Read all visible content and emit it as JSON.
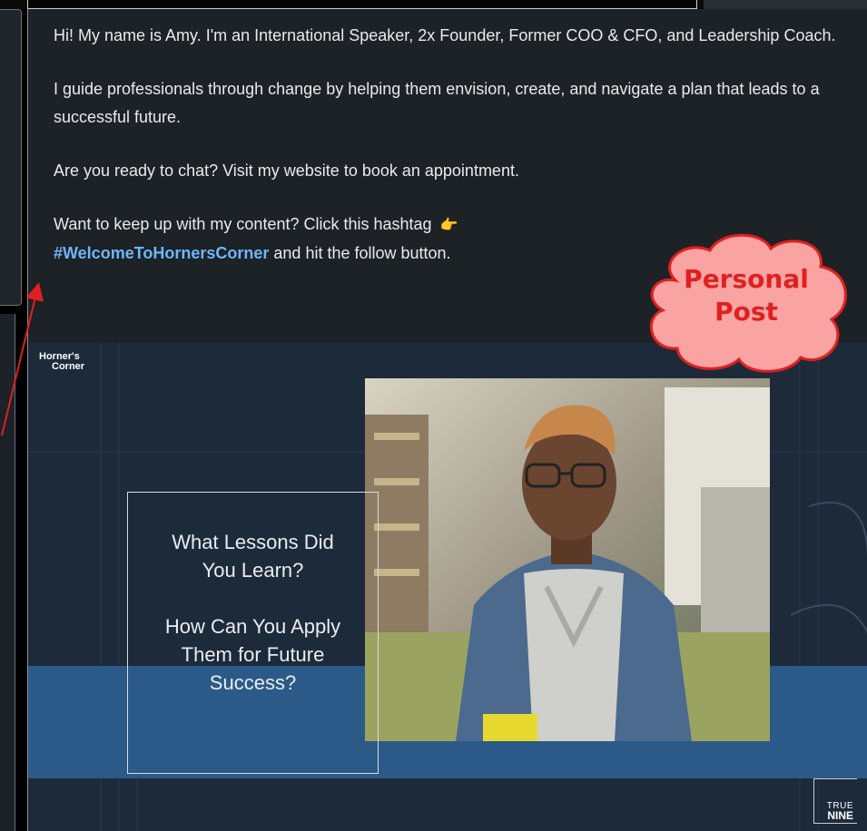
{
  "post": {
    "paragraphs": [
      "Hi! My name is Amy. I'm an International Speaker, 2x Founder, Former COO & CFO, and Leadership Coach.",
      "I guide professionals through change by helping them envision, create, and navigate a plan that leads to a successful future.",
      "Are you ready to chat? Visit my website to book an appointment."
    ],
    "follow_text": "Want to keep up with my content? Click this hashtag",
    "hashtag": "#WelcomeToHornersCorner",
    "hashtag_suffix": " and hit the follow button.",
    "pointing_icon": "👉"
  },
  "graphic": {
    "logo_line1": "Horner's",
    "logo_line2": "Corner",
    "question_1_line1": "What Lessons Did",
    "question_1_line2": "You Learn?",
    "question_2_line1": "How Can You Apply",
    "question_2_line2": "Them for Future",
    "question_2_line3": "Success?",
    "brand_line1": "TRUE",
    "brand_line2": "NINE",
    "band_color": "#2c5a88"
  },
  "annotation": {
    "label_line1": "Personal",
    "label_line2": "Post",
    "text_color": "#e02020",
    "fill_color": "#f9a3a3"
  }
}
